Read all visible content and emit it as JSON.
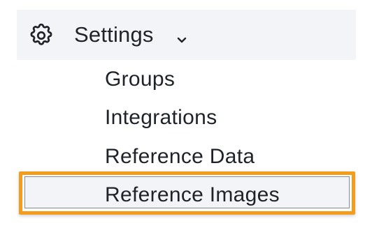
{
  "settings": {
    "label": "Settings",
    "icon": "gear-icon",
    "chevron_icon": "chevron-down-icon",
    "expanded": true,
    "items": [
      {
        "label": "Groups"
      },
      {
        "label": "Integrations"
      },
      {
        "label": "Reference Data"
      },
      {
        "label": "Reference Images",
        "highlighted": true
      }
    ]
  },
  "colors": {
    "header_background": "#f3f4f7",
    "highlight_border": "#f39c1e",
    "text": "#1f2329"
  }
}
